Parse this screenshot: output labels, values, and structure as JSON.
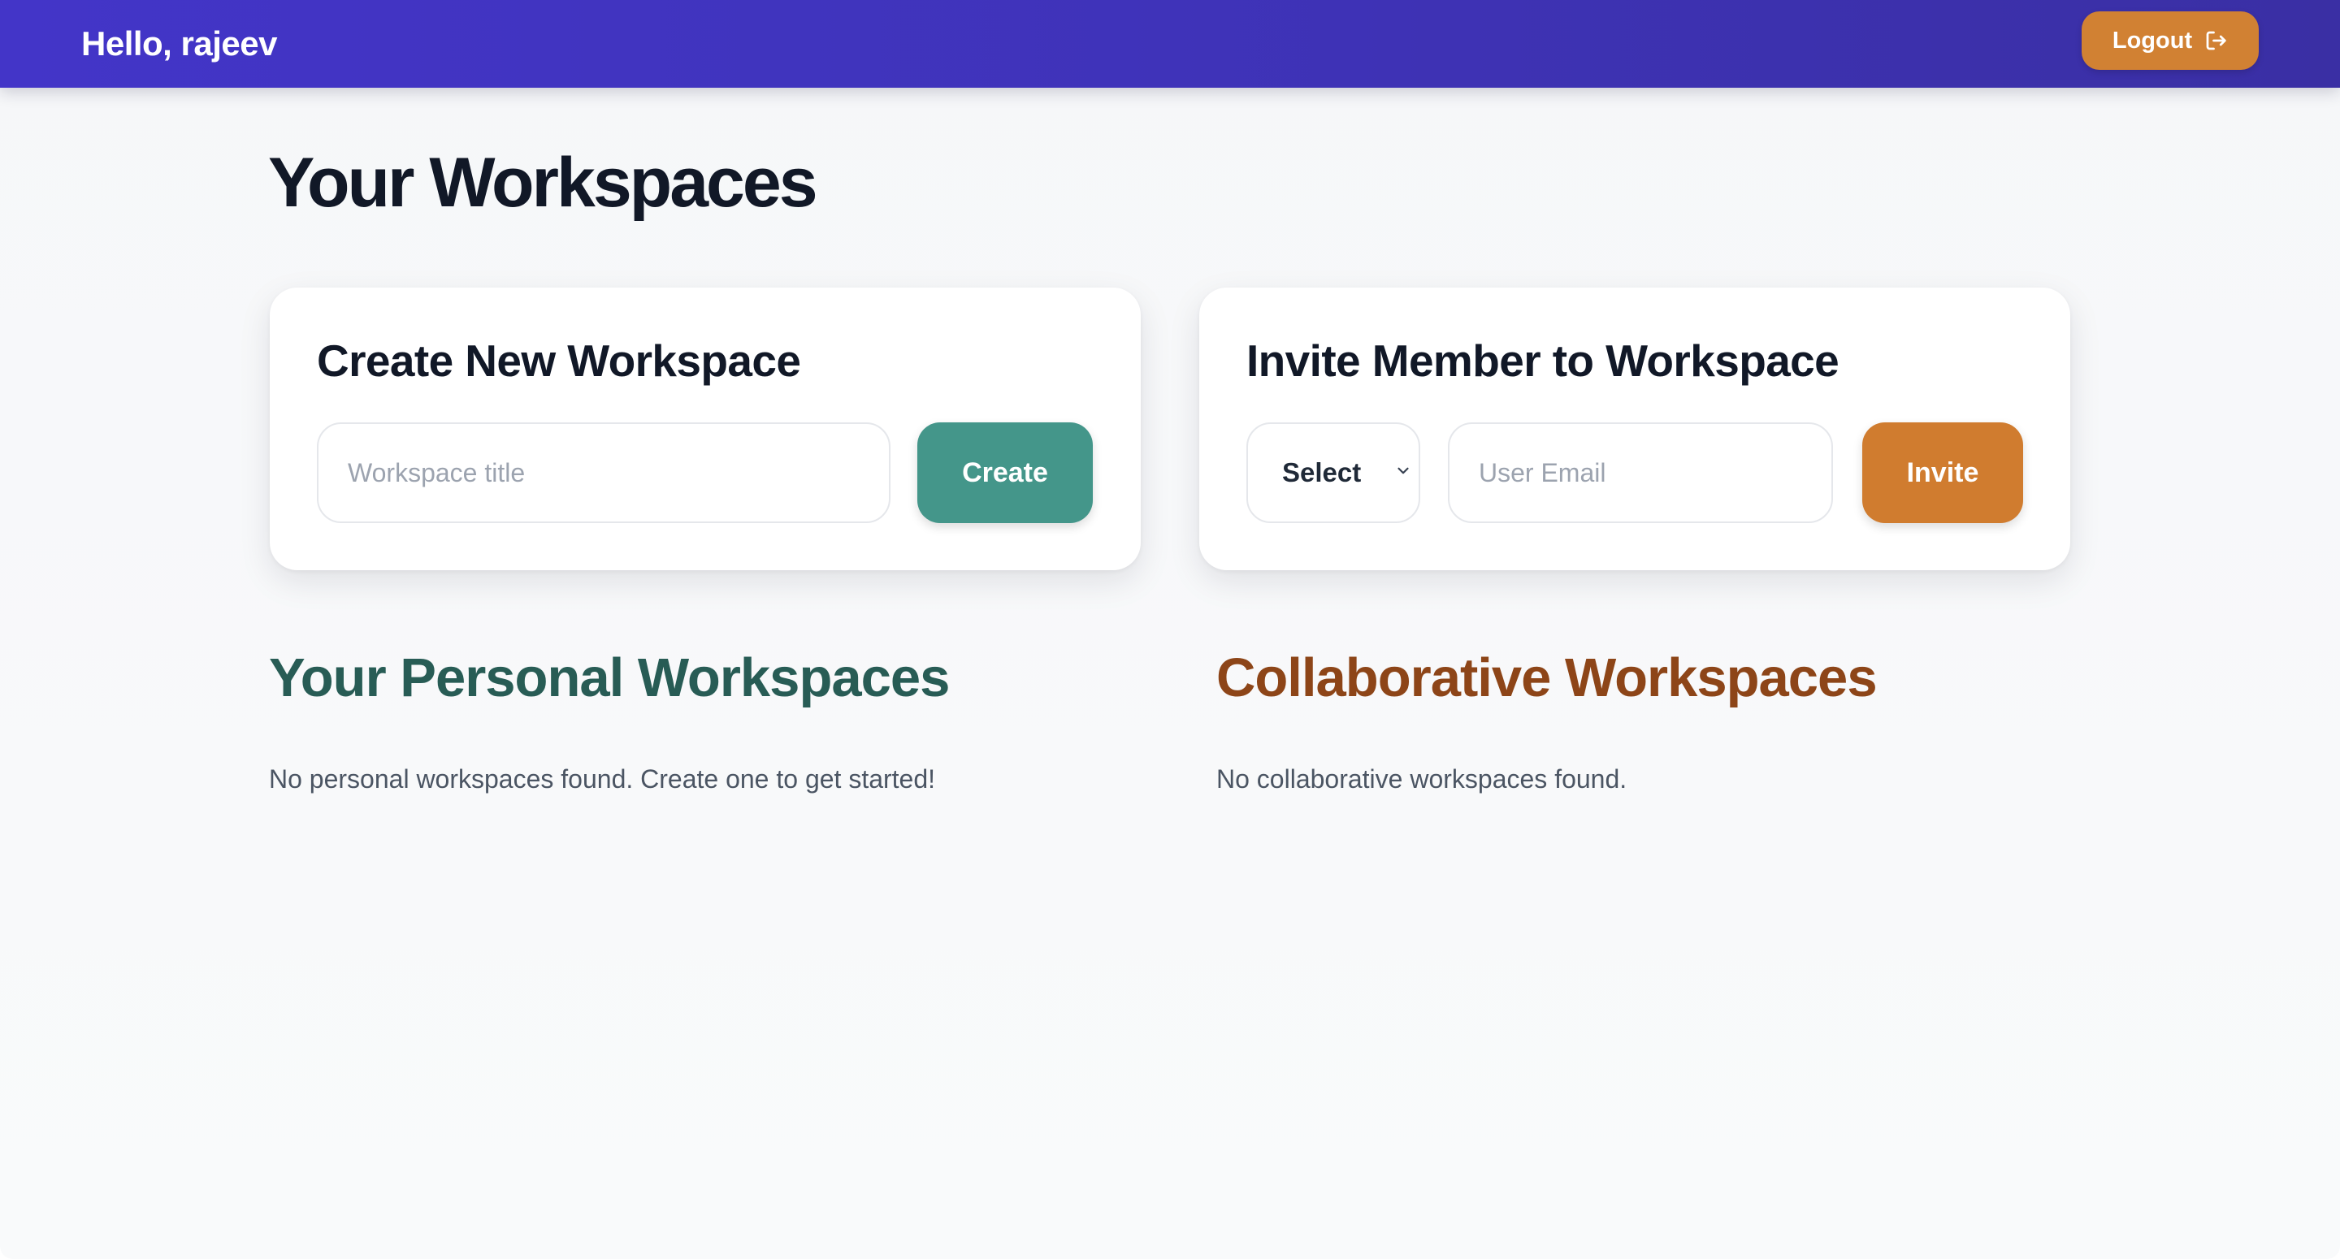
{
  "header": {
    "greeting": "Hello, rajeev",
    "logout_label": "Logout",
    "logout_icon": "logout-icon"
  },
  "page": {
    "title": "Your Workspaces"
  },
  "create_card": {
    "title": "Create New Workspace",
    "title_input_value": "",
    "title_input_placeholder": "Workspace title",
    "button_label": "Create"
  },
  "invite_card": {
    "title": "Invite Member to Workspace",
    "select_value": "Select",
    "email_input_value": "",
    "email_input_placeholder": "User Email",
    "button_label": "Invite"
  },
  "sections": {
    "personal": {
      "heading": "Your Personal Workspaces",
      "empty_message": "No personal workspaces found. Create one to get started!"
    },
    "collaborative": {
      "heading": "Collaborative Workspaces",
      "empty_message": "No collaborative workspaces found."
    }
  },
  "colors": {
    "header_gradient_start": "#4335c8",
    "header_gradient_end": "#3a2fa4",
    "logout_button": "#d18133",
    "create_button": "#44968a",
    "invite_button": "#d07c2f",
    "personal_heading": "#285c55",
    "collaborative_heading": "#8d4518"
  }
}
